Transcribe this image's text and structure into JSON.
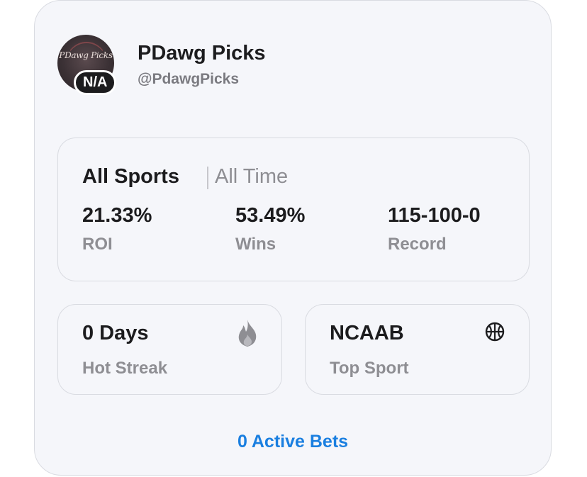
{
  "profile": {
    "avatar_text": "PDawg Picks",
    "badge": "N/A",
    "name": "PDawg Picks",
    "handle": "@PdawgPicks"
  },
  "summary": {
    "scope": "All Sports",
    "period": "All Time",
    "stats": [
      {
        "value": "21.33%",
        "label": "ROI"
      },
      {
        "value": "53.49%",
        "label": "Wins"
      },
      {
        "value": "115-100-0",
        "label": "Record"
      }
    ]
  },
  "streak": {
    "value": "0 Days",
    "label": "Hot Streak",
    "icon": "fire-icon"
  },
  "top_sport": {
    "value": "NCAAB",
    "label": "Top Sport",
    "icon": "basketball-icon"
  },
  "active_bets": "0 Active Bets",
  "colors": {
    "accent": "#1a7fe0",
    "muted": "#8e8e93",
    "card_bg": "#f5f6fa"
  }
}
